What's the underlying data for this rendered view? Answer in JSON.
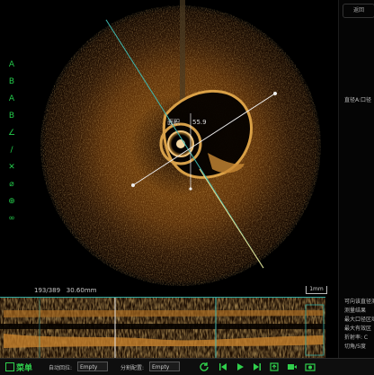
{
  "scan": {
    "frame_label": "193/389",
    "depth_label": "30.60mm",
    "scale_label": "1mm",
    "area_label_prefix": "面积",
    "area_value": "55.9"
  },
  "toolbar": {
    "items": [
      {
        "name": "area-a-tool",
        "glyph": "A"
      },
      {
        "name": "area-b-tool",
        "glyph": "B"
      },
      {
        "name": "area-c-tool",
        "glyph": "A"
      },
      {
        "name": "area-d-tool",
        "glyph": "B"
      },
      {
        "name": "angle-tool",
        "glyph": "∠"
      },
      {
        "name": "ruler-tool",
        "glyph": "/"
      },
      {
        "name": "delete-tool",
        "glyph": "✕"
      },
      {
        "name": "hide-tool",
        "glyph": "⌀"
      },
      {
        "name": "zoom-tool",
        "glyph": "⊕"
      },
      {
        "name": "link-tool",
        "glyph": "∞"
      }
    ]
  },
  "right_panel": {
    "tab_label": "返回",
    "note": "直径A:口径",
    "info_lines": [
      "可向该直径测量",
      "测量结果",
      "最大口径区域",
      "最大有效区",
      "折射率: C",
      "切角/5度"
    ]
  },
  "bottom": {
    "menu_label": "菜单",
    "field1_label": "自动回拉:",
    "field1_value": "Empty",
    "field2_label": "分割配置:",
    "field2_value": "Empty"
  },
  "colors": {
    "accent": "#23c94a",
    "teal": "#2fa8a0",
    "bottom_bg": "#0e0e0e"
  }
}
